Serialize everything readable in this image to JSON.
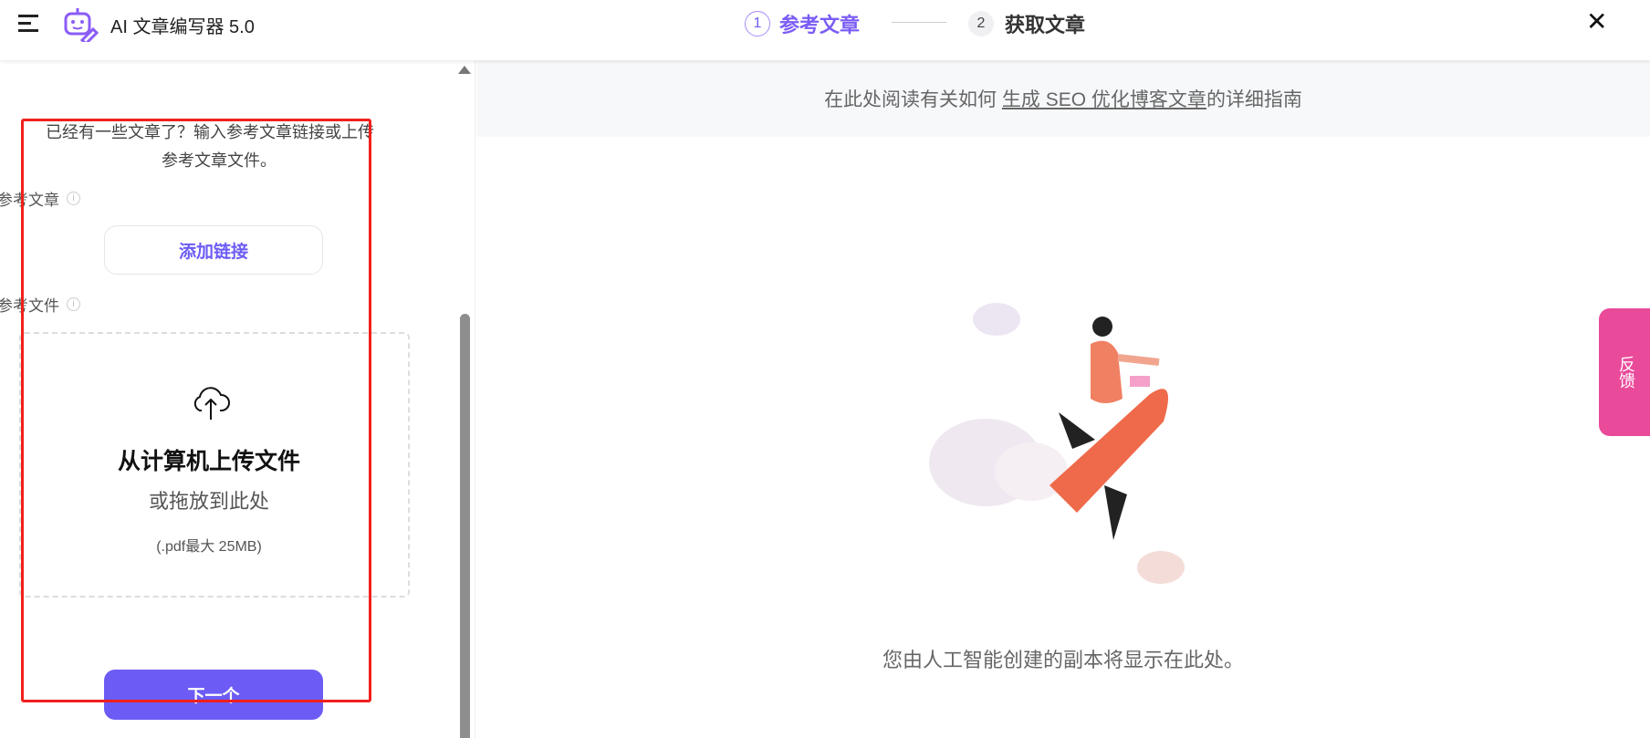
{
  "header": {
    "title": "AI 文章编写器 5.0",
    "steps": [
      {
        "num": "1",
        "label": "参考文章"
      },
      {
        "num": "2",
        "label": "获取文章"
      }
    ]
  },
  "left": {
    "intro_line1": "已经有一些文章了？输入参考文章链接或上传",
    "intro_line2": "参考文章文件。",
    "ref_article_label": "参考文章",
    "add_link_label": "添加链接",
    "ref_file_label": "参考文件",
    "upload_title": "从计算机上传文件",
    "upload_sub": "或拖放到此处",
    "upload_hint": "(.pdf最大 25MB)",
    "next_label": "下一个"
  },
  "right": {
    "guide_prefix": "在此处阅读有关如何 ",
    "guide_link": "生成 SEO 优化博客文章",
    "guide_suffix": "的详细指南",
    "caption": "您由人工智能创建的副本将显示在此处。"
  },
  "feedback_label": "反馈",
  "colors": {
    "accent": "#6c5cf5",
    "feedback": "#e94a9a",
    "highlight_box": "#f0201c"
  }
}
